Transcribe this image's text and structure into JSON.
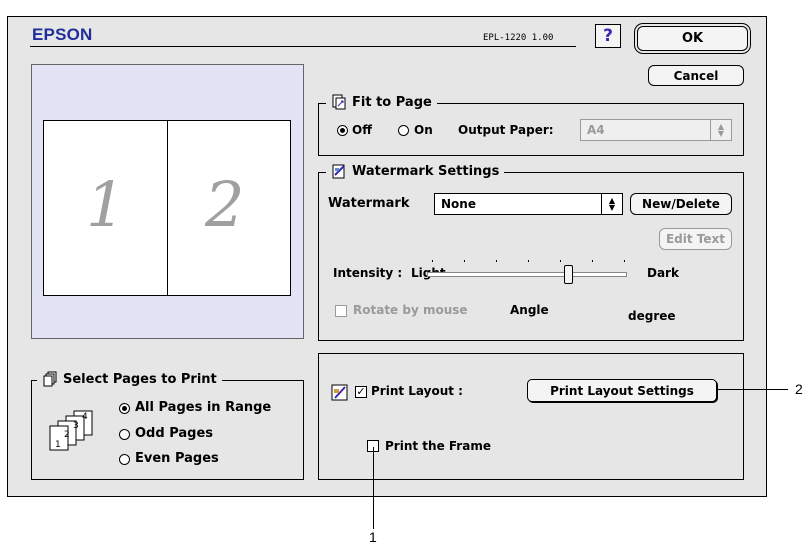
{
  "header": {
    "brand": "EPSON",
    "model": "EPL-1220  1.00",
    "help_label": "?",
    "ok_label": "OK",
    "cancel_label": "Cancel"
  },
  "preview": {
    "page_numbers": [
      "1",
      "2"
    ]
  },
  "fit_to_page": {
    "title": "Fit to Page",
    "off_label": "Off",
    "on_label": "On",
    "selected": "Off",
    "output_paper_label": "Output Paper:",
    "output_paper_value": "A4"
  },
  "watermark": {
    "title": "Watermark Settings",
    "watermark_label": "Watermark",
    "watermark_value": "None",
    "new_delete_label": "New/Delete",
    "edit_text_label": "Edit Text",
    "intensity_label": "Intensity :",
    "light_label": "Light",
    "dark_label": "Dark",
    "intensity_fraction": 0.7,
    "rotate_label": "Rotate by mouse",
    "angle_label": "Angle",
    "degree_label": "degree"
  },
  "print_layout": {
    "print_layout_label": "Print Layout :",
    "print_layout_checked": true,
    "settings_button_label": "Print Layout Settings",
    "print_frame_label": "Print the Frame",
    "print_frame_checked": false
  },
  "select_pages": {
    "title": "Select Pages to Print",
    "options": [
      "All Pages in Range",
      "Odd Pages",
      "Even Pages"
    ],
    "selected": "All Pages in Range",
    "icon_numbers": [
      "1",
      "2",
      "3",
      "4"
    ]
  },
  "callouts": {
    "one": "1",
    "two": "2"
  },
  "colors": {
    "brand": "#1f2e9c",
    "preview_bg": "#e2e4f6",
    "dialog_bg": "#e6e6e6"
  }
}
